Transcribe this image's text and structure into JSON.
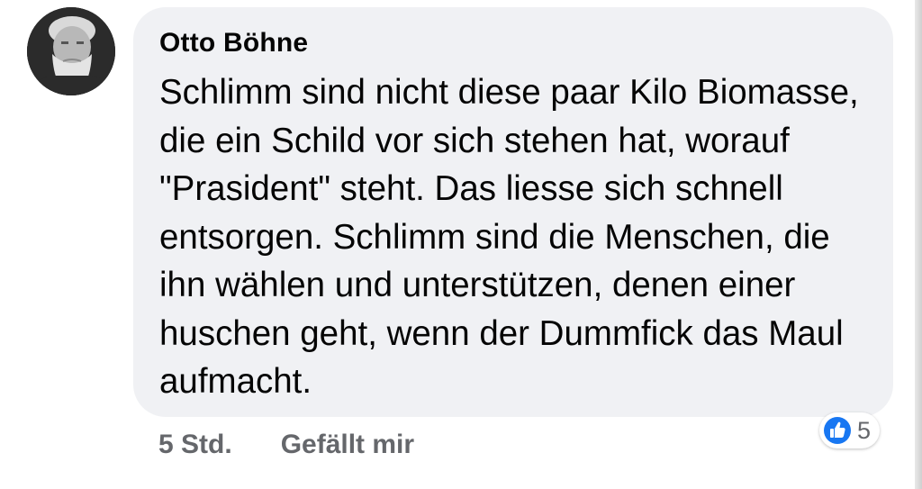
{
  "comment": {
    "author": "Otto Böhne",
    "text": "Schlimm sind nicht diese paar Kilo Biomasse, die ein Schild vor sich stehen hat, worauf \"Prasident\" steht. Das liesse sich schnell entsorgen. Schlimm sind die Menschen, die ihn wählen und unterstützen, denen einer huschen geht, wenn der Dummfick das Maul aufmacht.",
    "timestamp": "5 Std.",
    "like_action": "Gefällt mir",
    "reaction_icon": "like-thumbs-up-icon",
    "reaction_count": "5"
  },
  "colors": {
    "bubble_background": "#f0f1f4",
    "text": "#050505",
    "secondary_text": "#65676b",
    "like_blue": "#1877f2"
  }
}
